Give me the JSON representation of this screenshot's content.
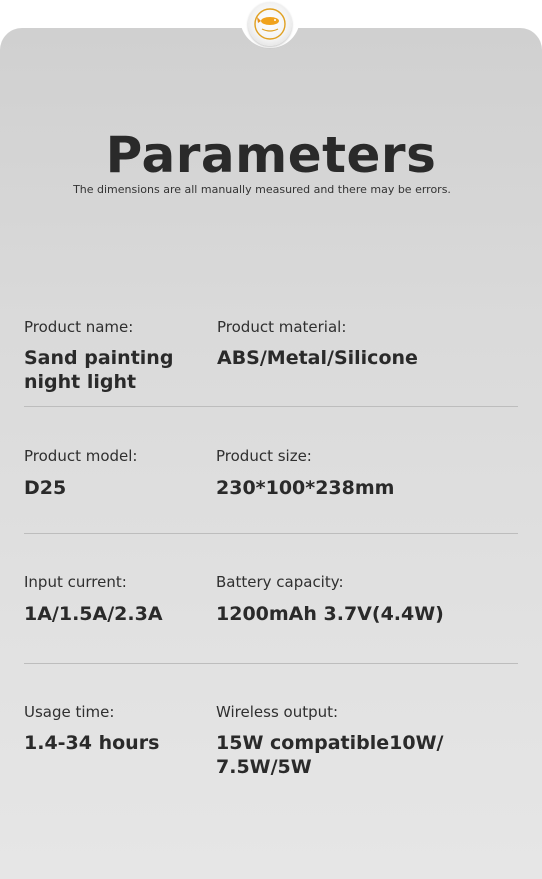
{
  "header": {
    "title": "Parameters",
    "subtitle": "The dimensions are all manually measured and there may be errors."
  },
  "logo": {
    "icon": "fish-bowl-logo-icon"
  },
  "specs": [
    {
      "label": "Product name:",
      "value_lines": [
        "Sand painting",
        "night light"
      ]
    },
    {
      "label": "Product material:",
      "value_lines": [
        "ABS/Metal/Silicone"
      ]
    },
    {
      "label": "Product model:",
      "value_lines": [
        "D25"
      ]
    },
    {
      "label": "Product size:",
      "value_lines": [
        "230*100*238mm"
      ]
    },
    {
      "label": "Input current:",
      "value_lines": [
        "1A/1.5A/2.3A"
      ]
    },
    {
      "label": "Battery capacity:",
      "value_lines": [
        "1200mAh 3.7V(4.4W)"
      ]
    },
    {
      "label": "Usage time:",
      "value_lines": [
        "1.4-34 hours"
      ]
    },
    {
      "label": "Wireless output:",
      "value_lines": [
        "15W compatible10W/",
        "7.5W/5W"
      ]
    }
  ],
  "colors": {
    "background": "#d8d8d8",
    "text": "#2a2a2a",
    "divider": "#bdbdbd"
  }
}
